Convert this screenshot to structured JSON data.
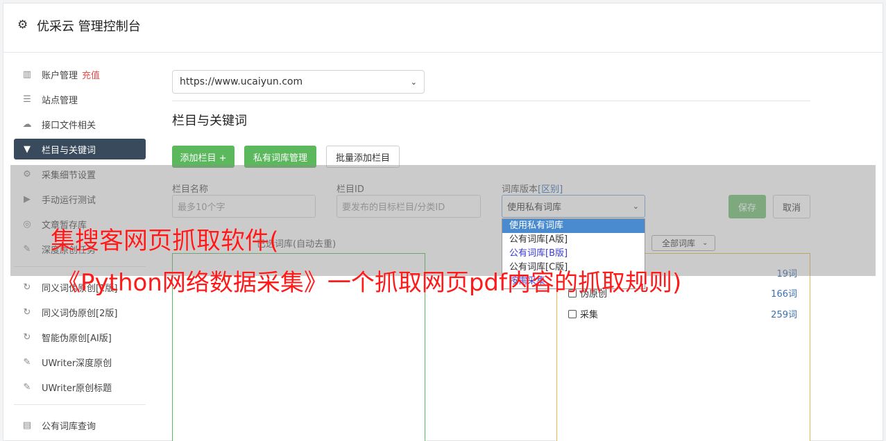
{
  "header": {
    "title": "优采云 管理控制台"
  },
  "sidebar": {
    "items": [
      {
        "label": "账户管理",
        "extra": "充值",
        "icon": "bar-chart-icon"
      },
      {
        "label": "站点管理",
        "icon": "server-icon"
      },
      {
        "label": "接口文件相关",
        "icon": "cloud-upload-icon"
      },
      {
        "label": "栏目与关键词",
        "icon": "filter-icon",
        "active": true
      },
      {
        "label": "采集细节设置",
        "icon": "gears-icon"
      },
      {
        "label": "手动运行测试",
        "icon": "play-circle-icon"
      },
      {
        "label": "文章暂存库",
        "icon": "database-icon"
      },
      {
        "label": "深度原创任务",
        "icon": "edit-icon"
      }
    ],
    "items2": [
      {
        "label": "同义词伪原创[1版]",
        "icon": "refresh-icon"
      },
      {
        "label": "同义词伪原创[2版]",
        "icon": "refresh-icon"
      },
      {
        "label": "智能伪原创[AI版]",
        "icon": "refresh-icon"
      },
      {
        "label": "UWriter深度原创",
        "icon": "edit-icon"
      },
      {
        "label": "UWriter原创标题",
        "icon": "edit-icon"
      }
    ],
    "items3": [
      {
        "label": "公有词库查询",
        "icon": "book-icon"
      }
    ]
  },
  "main": {
    "site_select": "https://www.ucaiyun.com",
    "section_title": "栏目与关键词",
    "buttons": {
      "add_column": "添加栏目 +",
      "private_lib": "私有词库管理",
      "batch_add": "批量添加栏目"
    },
    "form": {
      "name_label": "栏目名称",
      "name_placeholder": "最多10个字",
      "id_label": "栏目ID",
      "id_placeholder": "要发布的目标栏目/分类ID",
      "version_label": "词库版本",
      "version_link": "[区别]",
      "version_value": "使用私有词库",
      "save": "保存",
      "cancel": "取消"
    },
    "dropdown_options": [
      "使用私有词库",
      "公有词库[A版]",
      "公有词库[B版]",
      "公有词库[C版]",
      "按需采集"
    ],
    "left_box_label": "已选词库(自动去重)",
    "lib_filter": "全部词库",
    "libs": [
      {
        "name": "伪原创",
        "count": "166词"
      },
      {
        "name": "采集",
        "count": "259词"
      }
    ],
    "lib_top_count": "19词"
  },
  "watermark": {
    "line1": "集搜客网页抓取软件(",
    "line2": "《Python网络数据采集》一个抓取网页pdf内容的抓取规则)"
  }
}
